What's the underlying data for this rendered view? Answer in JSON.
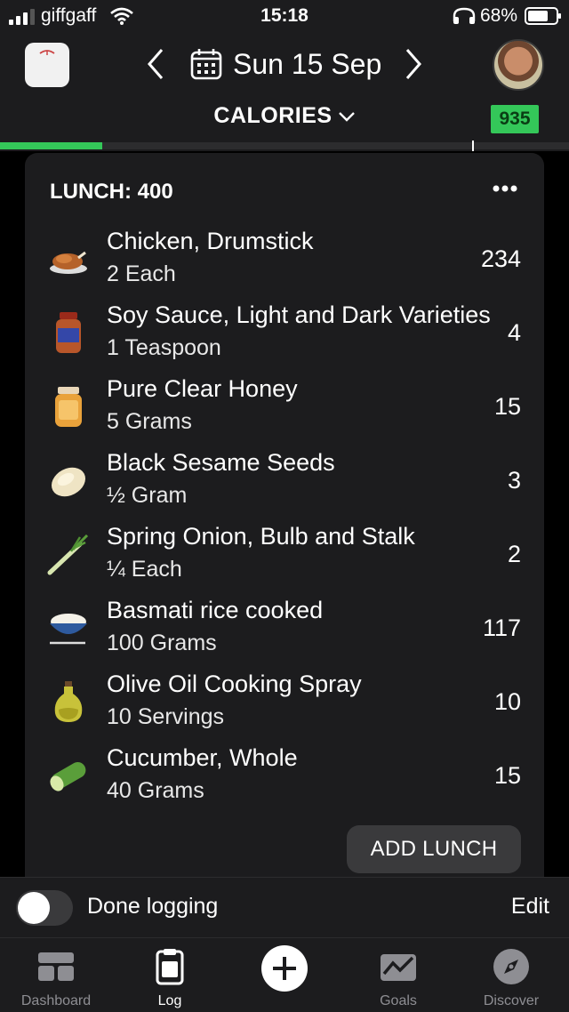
{
  "status_bar": {
    "carrier": "giffgaff",
    "time": "15:18",
    "battery": "68%"
  },
  "header": {
    "date": "Sun 15 Sep",
    "metric_label": "CALORIES",
    "remaining_badge": "935",
    "accent_color": "#34c759",
    "progress_fraction": 0.18
  },
  "meal": {
    "title": "LUNCH: 400",
    "items": [
      {
        "name": "Chicken, Drumstick",
        "quantity": "2 Each",
        "calories": "234",
        "icon": "drumstick-icon"
      },
      {
        "name": "Soy Sauce, Light and Dark Varieties",
        "quantity": "1 Teaspoon",
        "calories": "4",
        "icon": "sauce-bottle-icon"
      },
      {
        "name": "Pure Clear Honey",
        "quantity": "5 Grams",
        "calories": "15",
        "icon": "honey-jar-icon"
      },
      {
        "name": "Black Sesame Seeds",
        "quantity": "½ Gram",
        "calories": "3",
        "icon": "seed-icon"
      },
      {
        "name": "Spring Onion, Bulb and Stalk",
        "quantity": "¼ Each",
        "calories": "2",
        "icon": "spring-onion-icon"
      },
      {
        "name": "Basmati rice cooked",
        "quantity": "100 Grams",
        "calories": "117",
        "icon": "rice-bowl-icon"
      },
      {
        "name": "Olive Oil Cooking Spray",
        "quantity": "10 Servings",
        "calories": "10",
        "icon": "olive-oil-icon"
      },
      {
        "name": "Cucumber, Whole",
        "quantity": "40 Grams",
        "calories": "15",
        "icon": "cucumber-icon"
      }
    ],
    "add_label": "ADD LUNCH"
  },
  "done_logging": {
    "label": "Done logging",
    "edit_label": "Edit",
    "toggled": false
  },
  "tabbar": {
    "tabs": [
      {
        "label": "Dashboard",
        "icon": "dashboard-icon"
      },
      {
        "label": "Log",
        "icon": "log-icon"
      },
      {
        "label": "",
        "icon": "add-icon"
      },
      {
        "label": "Goals",
        "icon": "goals-icon"
      },
      {
        "label": "Discover",
        "icon": "compass-icon"
      }
    ]
  }
}
